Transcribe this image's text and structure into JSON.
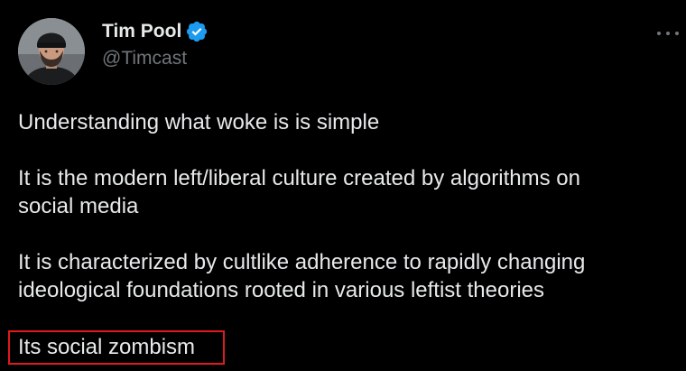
{
  "author": {
    "display_name": "Tim Pool",
    "handle": "@Timcast",
    "verified": true,
    "avatar_icon": "avatar-photo"
  },
  "menu": {
    "icon": "more-horizontal-icon"
  },
  "tweet": {
    "paragraphs": [
      [
        "Understanding what woke is is simple"
      ],
      [
        "It is the modern left/liberal culture created by algorithms on",
        "social media"
      ],
      [
        "It is characterized by cultlike adherence to rapidly changing",
        "ideological foundations rooted in various leftist theories"
      ]
    ],
    "highlighted_line": "Its social zombism"
  },
  "colors": {
    "background": "#000000",
    "text": "#e7e9ea",
    "secondary_text": "#71767b",
    "verified_badge": "#1d9bf0",
    "highlight_box": "#e0191c"
  }
}
